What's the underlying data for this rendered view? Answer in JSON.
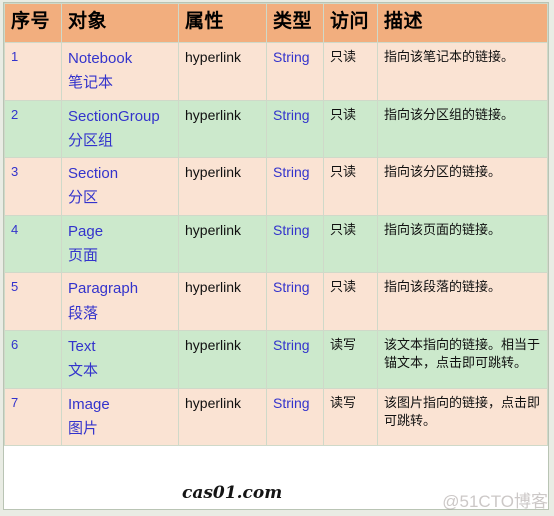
{
  "table": {
    "headers": [
      {
        "key": "index",
        "label": "序号"
      },
      {
        "key": "object",
        "label": "对象"
      },
      {
        "key": "property",
        "label": "属性"
      },
      {
        "key": "type",
        "label": "类型"
      },
      {
        "key": "access",
        "label": "访问"
      },
      {
        "key": "description",
        "label": "描述"
      }
    ],
    "rows": [
      {
        "index": "1",
        "object_en": "Notebook",
        "object_cn": "笔记本",
        "property": "hyperlink",
        "type": "String",
        "access": "只读",
        "description": "指向该笔记本的链接。"
      },
      {
        "index": "2",
        "object_en": "SectionGroup",
        "object_cn": "分区组",
        "property": "hyperlink",
        "type": "String",
        "access": "只读",
        "description": "指向该分区组的链接。"
      },
      {
        "index": "3",
        "object_en": "Section",
        "object_cn": "分区",
        "property": "hyperlink",
        "type": "String",
        "access": "只读",
        "description": "指向该分区的链接。"
      },
      {
        "index": "4",
        "object_en": "Page",
        "object_cn": "页面",
        "property": "hyperlink",
        "type": "String",
        "access": "只读",
        "description": "指向该页面的链接。"
      },
      {
        "index": "5",
        "object_en": "Paragraph",
        "object_cn": "段落",
        "property": "hyperlink",
        "type": "String",
        "access": "只读",
        "description": "指向该段落的链接。"
      },
      {
        "index": "6",
        "object_en": "Text",
        "object_cn": "文本",
        "property": "hyperlink",
        "type": "String",
        "access": "读写",
        "description": "该文本指向的链接。相当于锚文本，点击即可跳转。"
      },
      {
        "index": "7",
        "object_en": "Image",
        "object_cn": "图片",
        "property": "hyperlink",
        "type": "String",
        "access": "读写",
        "description": "该图片指向的链接，点击即可跳转。"
      }
    ]
  },
  "watermarks": {
    "site": "cas01.com",
    "blog": "@51CTO博客"
  },
  "colors": {
    "header_bg": "#F2AE7E",
    "row_odd_bg": "#FAE3D3",
    "row_even_bg": "#CCE9CC",
    "link_text": "#3333CC",
    "body_text": "#101010",
    "border": "#CFD9C9"
  }
}
